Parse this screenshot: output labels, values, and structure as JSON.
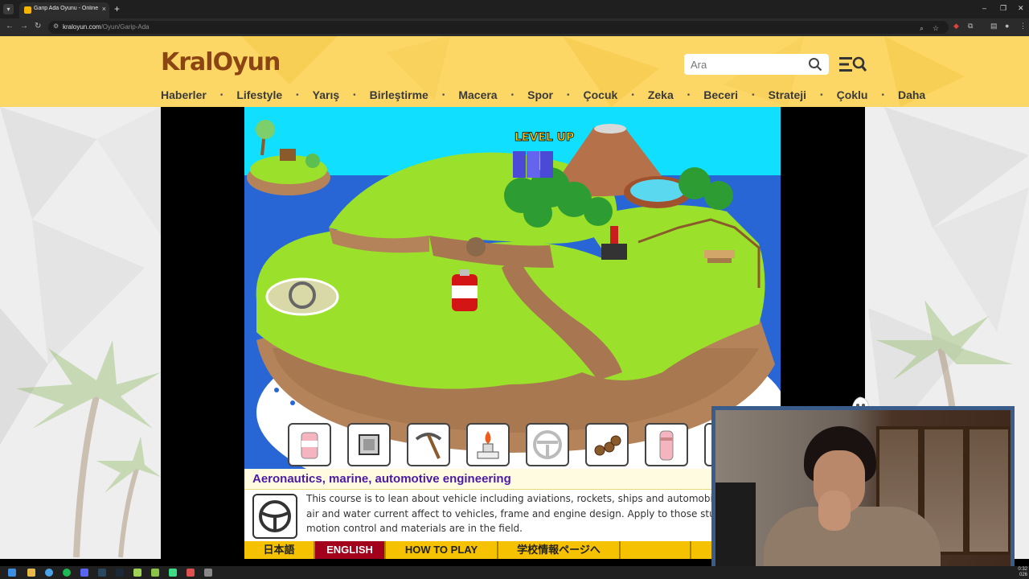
{
  "browser": {
    "tab_title": "Garip Ada Oyunu - Online ücre",
    "new_tab": "+",
    "url_domain": "kraloyun.com",
    "url_path": "/Oyun/Garip-Ada"
  },
  "site": {
    "logo": "KralOyun",
    "search": {
      "placeholder": "Ara"
    },
    "nav": [
      "Haberler",
      "Lifestyle",
      "Yarış",
      "Birleştirme",
      "Macera",
      "Spor",
      "Çocuk",
      "Zeka",
      "Beceri",
      "Strateji",
      "Çoklu",
      "Daha"
    ],
    "nav_separator": "•"
  },
  "game": {
    "level_up": "LEVEL UP",
    "toolbar": [
      "fuel-can-icon",
      "chip-icon",
      "pickaxe-icon",
      "burner-icon",
      "steering-wheel-icon",
      "logs-icon",
      "canister-icon"
    ],
    "course_title": "Aeronautics, marine, automotive engineering",
    "course_description": "This course is to lean about vehicle including aviations, rockets, ships and automobile\nair and water current affect to vehicles, frame and engine design. Apply to those stud\nmotion control and materials are in the field.",
    "lang_buttons": [
      "日本語",
      "ENGLISH",
      "HOW TO PLAY",
      "学校情報ページへ",
      ""
    ],
    "active_lang": "ENGLISH"
  },
  "colors": {
    "header_bg": "#fcd765",
    "sky": "#11dfff",
    "ocean": "#2866d6",
    "grass": "#9be02a",
    "cliff": "#b5835a",
    "course_title": "#4b1aa3",
    "lang_bar": "#f6c200",
    "lang_active": "#a3001b"
  },
  "taskbar": {
    "time": "0:32",
    "year": "026"
  }
}
